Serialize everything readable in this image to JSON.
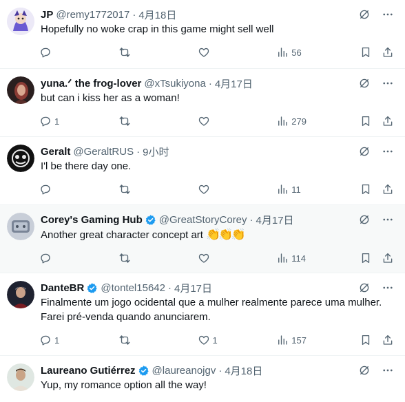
{
  "tweets": [
    {
      "name": "JP",
      "handle": "@remy1772017",
      "time": "4月18日",
      "verified": false,
      "text": "Hopefully no woke crap in this game might sell well",
      "replies": "",
      "retweets": "",
      "likes": "",
      "views": "56",
      "avatar_color": "#6b5bd2"
    },
    {
      "name": "yuna.ᐟ the frog-lover",
      "handle": "@xTsukiyona",
      "time": "4月17日",
      "verified": false,
      "text": "but can i kiss her as a woman!",
      "replies": "1",
      "retweets": "",
      "likes": "",
      "views": "279",
      "avatar_color": "#3a2a2a"
    },
    {
      "name": "Geralt",
      "handle": "@GeraltRUS",
      "time": "9小时",
      "verified": false,
      "text": "I'l be there day one.",
      "replies": "",
      "retweets": "",
      "likes": "",
      "views": "11",
      "avatar_color": "#111111"
    },
    {
      "name": "Corey's Gaming Hub",
      "handle": "@GreatStoryCorey",
      "time": "4月17日",
      "verified": true,
      "text": "Another great character concept art",
      "emoji": "👏👏👏",
      "replies": "",
      "retweets": "",
      "likes": "",
      "views": "114",
      "avatar_color": "#7a8597"
    },
    {
      "name": "DanteBR",
      "handle": "@tontel15642",
      "time": "4月17日",
      "verified": true,
      "text": "Finalmente um jogo ocidental que a mulher realmente parece uma mulher. Farei pré-venda quando anunciarem.",
      "replies": "1",
      "retweets": "",
      "likes": "1",
      "views": "157",
      "avatar_color": "#2b2b3a"
    },
    {
      "name": "Laureano Gutiérrez",
      "handle": "@laureanojgv",
      "time": "4月18日",
      "verified": true,
      "text": "Yup, my romance option all the way!",
      "replies": "",
      "retweets": "",
      "likes": "",
      "views": "",
      "avatar_color": "#c9a487"
    }
  ],
  "colors": {
    "text": "#0f1419",
    "muted": "#536471",
    "verified": "#1d9bf0",
    "highlight": "#f7f9f9",
    "divider": "#eff3f4"
  },
  "icons": [
    "grok-icon",
    "more-icon",
    "reply-icon",
    "retweet-icon",
    "like-icon",
    "views-icon",
    "bookmark-icon",
    "share-icon",
    "verified-badge-icon"
  ]
}
